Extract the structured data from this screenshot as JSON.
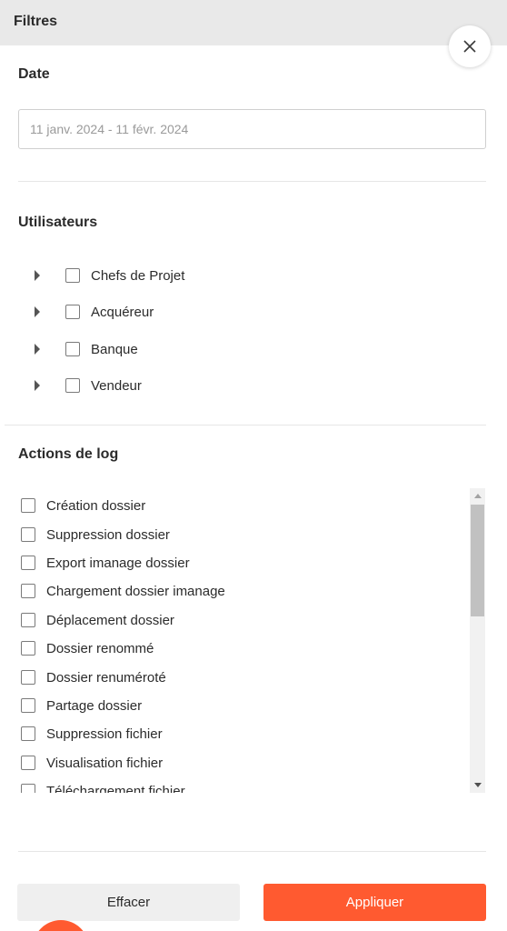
{
  "header": {
    "title": "Filtres",
    "close_icon": "close-icon"
  },
  "date": {
    "title": "Date",
    "placeholder": "11 janv. 2024 - 11 févr. 2024"
  },
  "users": {
    "title": "Utilisateurs",
    "items": [
      {
        "label": "Chefs de Projet"
      },
      {
        "label": "Acquéreur"
      },
      {
        "label": "Banque"
      },
      {
        "label": "Vendeur"
      }
    ]
  },
  "log_actions": {
    "title": "Actions de log",
    "items": [
      {
        "label": "Création dossier"
      },
      {
        "label": "Suppression dossier"
      },
      {
        "label": "Export imanage dossier"
      },
      {
        "label": "Chargement dossier imanage"
      },
      {
        "label": "Déplacement dossier"
      },
      {
        "label": "Dossier renommé"
      },
      {
        "label": "Dossier renuméroté"
      },
      {
        "label": "Partage dossier"
      },
      {
        "label": "Suppression fichier"
      },
      {
        "label": "Visualisation fichier"
      },
      {
        "label": "Téléchargement fichier"
      }
    ]
  },
  "footer": {
    "clear_label": "Effacer",
    "apply_label": "Appliquer"
  },
  "colors": {
    "accent": "#ff5a30",
    "header_bg": "#e9e9e9"
  }
}
